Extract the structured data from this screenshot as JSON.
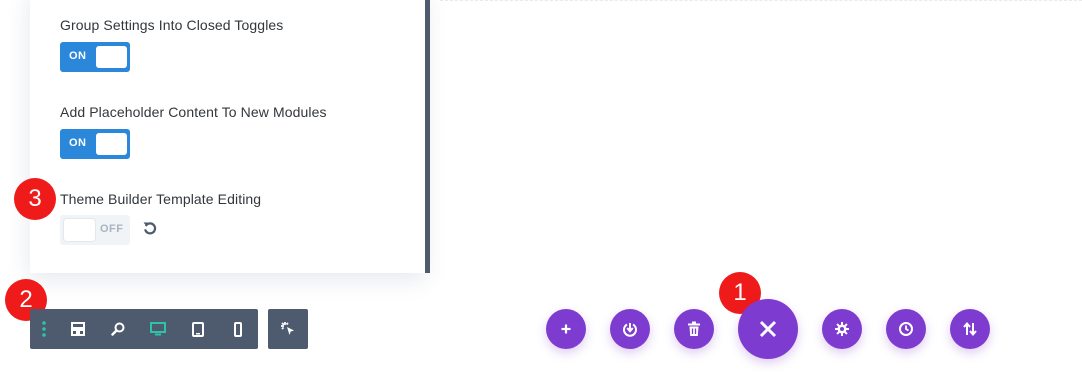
{
  "settings_panel": {
    "settings": [
      {
        "label": "Group Settings Into Closed Toggles",
        "toggle_text": "ON",
        "state": "on"
      },
      {
        "label": "Add Placeholder Content To New Modules",
        "toggle_text": "ON",
        "state": "on"
      },
      {
        "label": "Theme Builder Template Editing",
        "toggle_text": "OFF",
        "state": "off"
      }
    ],
    "reset_icon": "undo-icon"
  },
  "badges": [
    "1",
    "2",
    "3"
  ],
  "bottom_toolbar": {
    "items": [
      "drag-handle-icon",
      "wireframe-view-icon",
      "zoom-icon",
      "desktop-view-icon",
      "tablet-view-icon",
      "phone-view-icon"
    ],
    "active_item": "desktop-view-icon",
    "extra": "click-mode-icon"
  },
  "page_actions": {
    "items": [
      "add-icon",
      "portability-icon",
      "clear-layout-icon",
      "close-icon",
      "page-settings-icon",
      "history-icon",
      "sort-icon"
    ],
    "primary": "close-icon"
  },
  "colors": {
    "toggle_on": "#2b87da",
    "toggle_off": "#f1f4f7",
    "panel_bar": "#4e5b6e",
    "toolbar_bg": "#4e5b6e",
    "toolbar_active_icon": "#29c4a9",
    "action_purple": "#7e3bd0",
    "badge_red": "#ef1a1a"
  }
}
